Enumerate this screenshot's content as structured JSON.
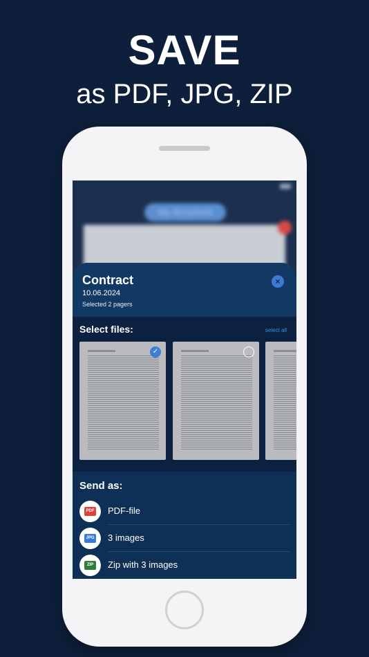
{
  "headline": "SAVE",
  "subline": "as PDF, JPG, ZIP",
  "background_app": {
    "document_pill": "My document"
  },
  "sheet": {
    "title": "Contract",
    "date": "10.06.2024",
    "selected_text": "Selected 2 pagers",
    "close_icon": "×"
  },
  "files": {
    "title": "Select files:",
    "select_all": "select all",
    "items": [
      {
        "selected": true,
        "check_glyph": "✓"
      },
      {
        "selected": false
      },
      {
        "selected": false
      }
    ]
  },
  "send": {
    "title": "Send as:",
    "options": [
      {
        "badge": "PDF",
        "label": "PDF-file",
        "color": "#e0413a"
      },
      {
        "badge": "JPG",
        "label": "3 images",
        "color": "#3b78d8"
      },
      {
        "badge": "ZIP",
        "label": "Zip with 3 images",
        "color": "#2f7d3c"
      }
    ]
  },
  "colors": {
    "page_background": "#0d1f3a",
    "sheet": "#0f3056",
    "accent": "#3c7fd4"
  }
}
